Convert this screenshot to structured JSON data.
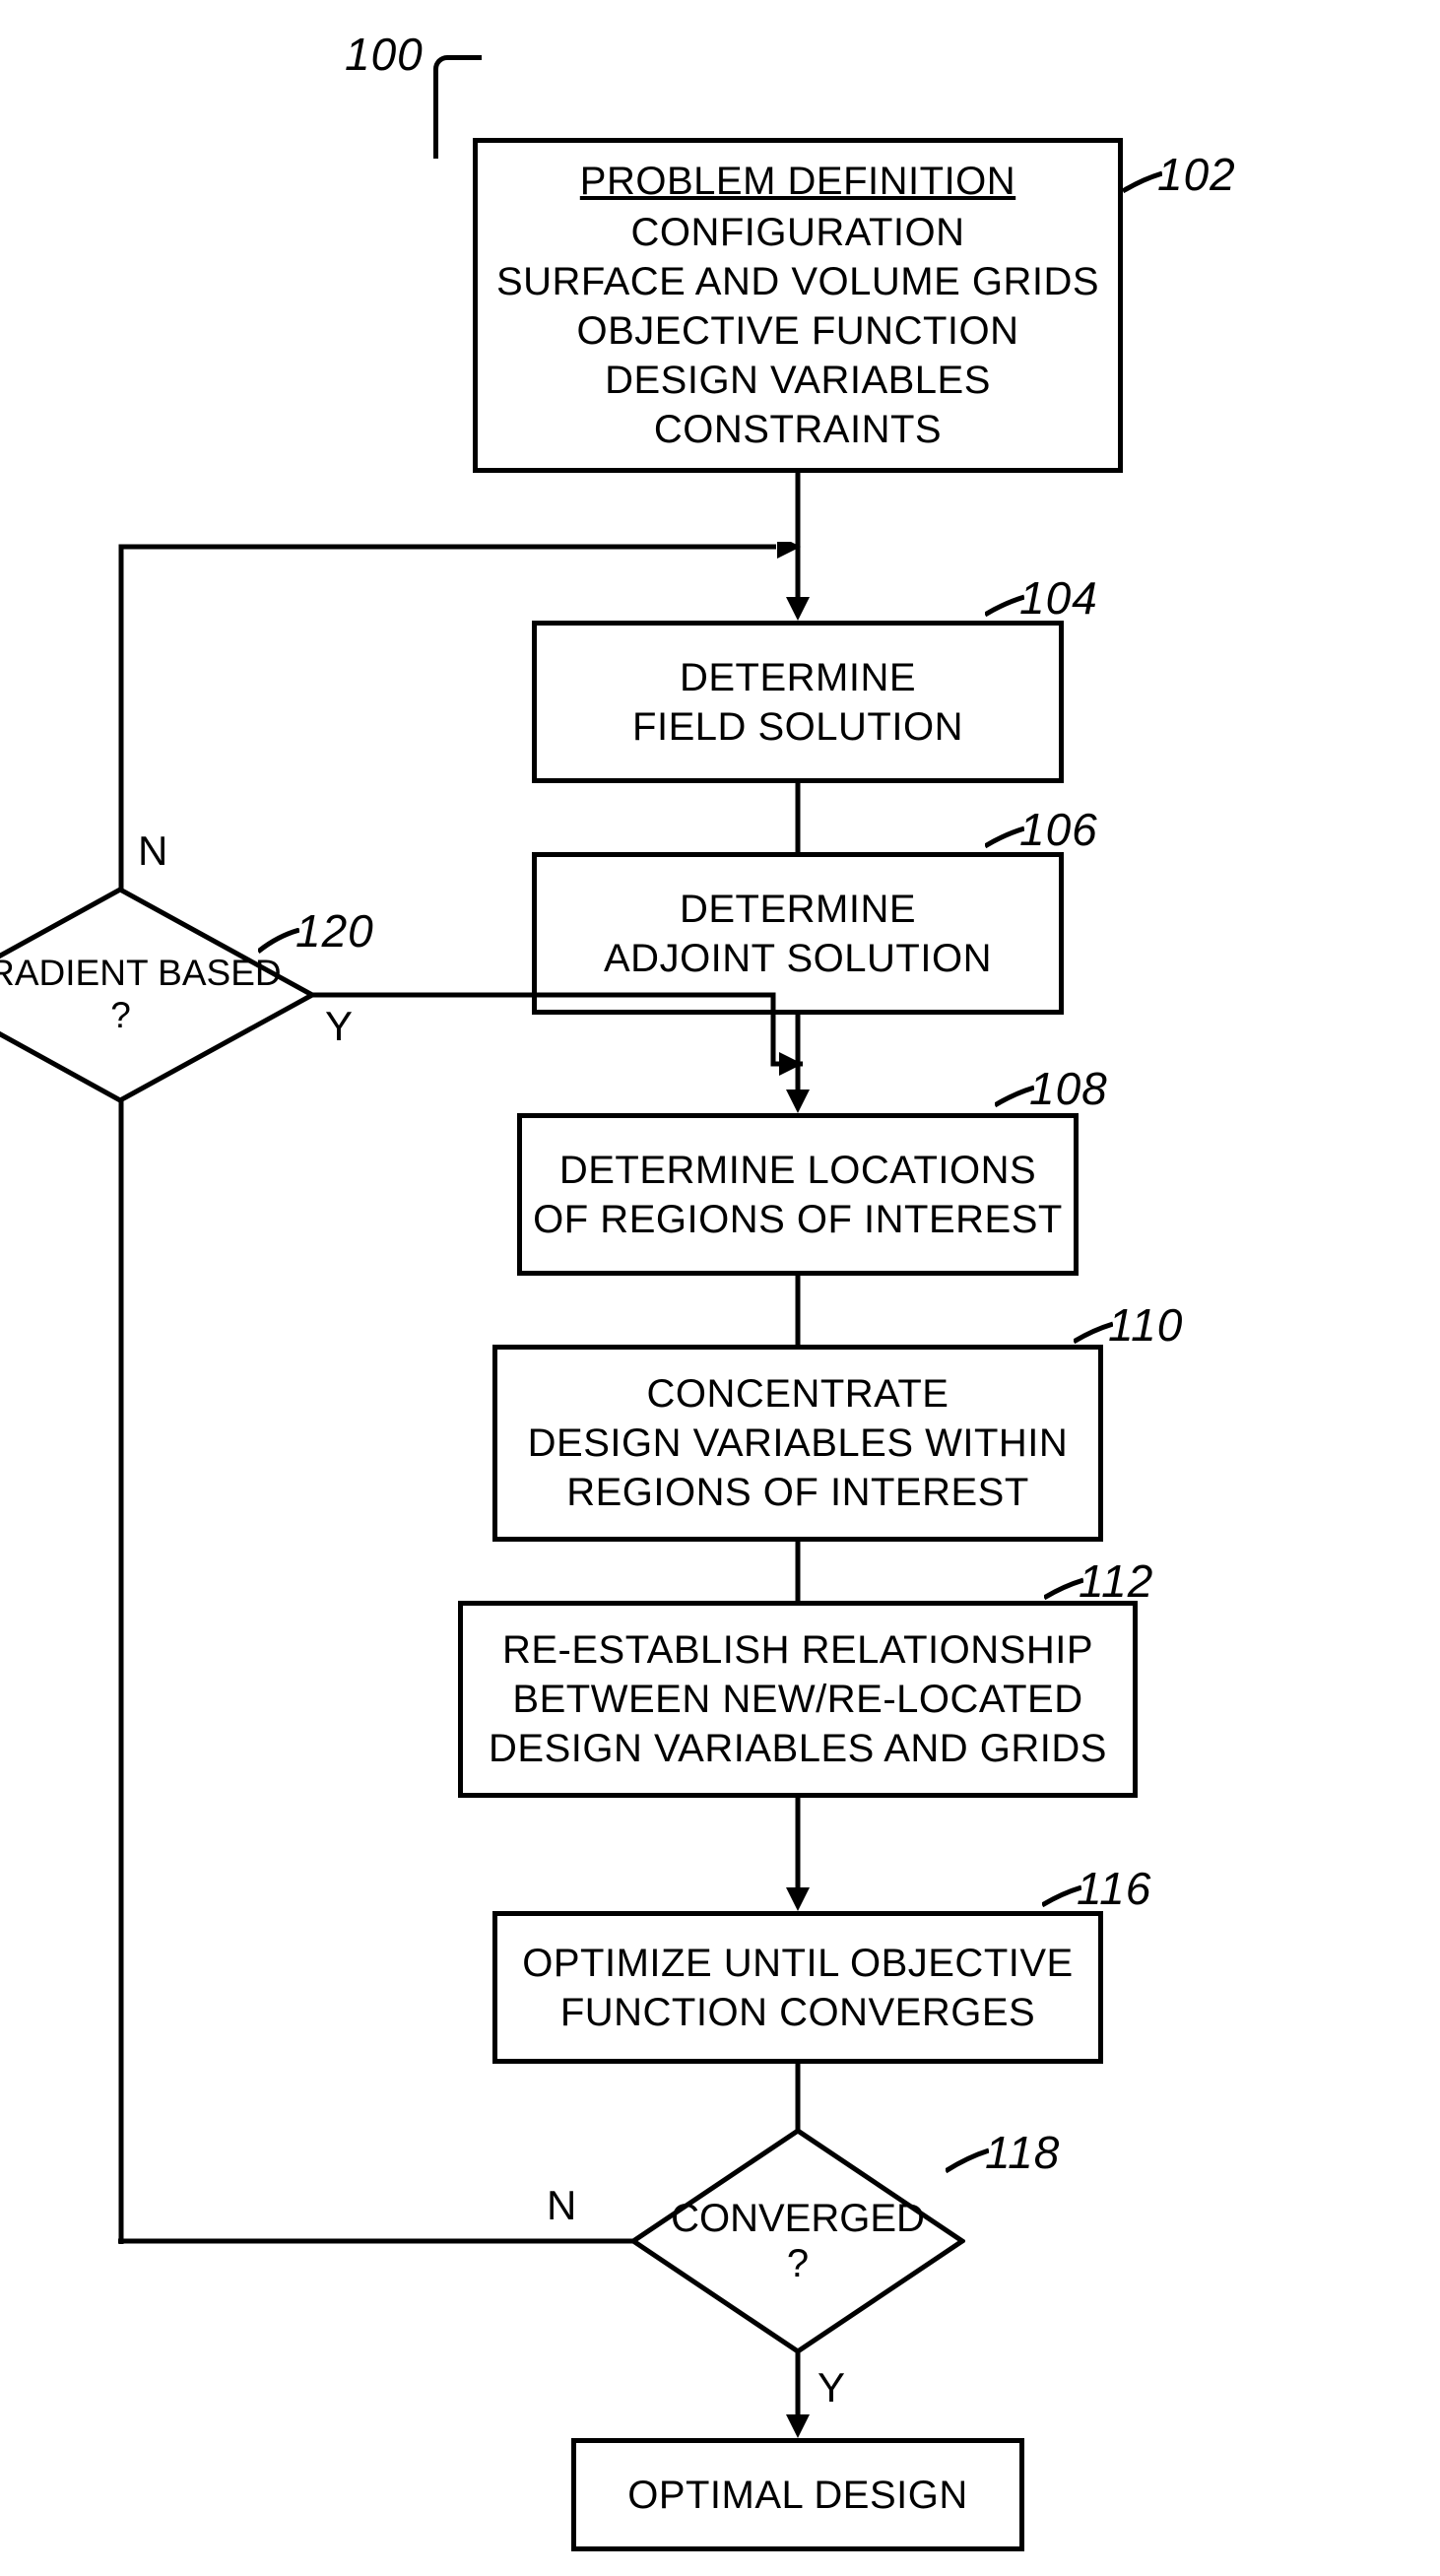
{
  "figure_label": "100",
  "boxes": {
    "b102": {
      "label": "102",
      "title": "PROBLEM DEFINITION",
      "lines": [
        "CONFIGURATION",
        "SURFACE AND VOLUME GRIDS",
        "OBJECTIVE FUNCTION",
        "DESIGN VARIABLES",
        "CONSTRAINTS"
      ]
    },
    "b104": {
      "label": "104",
      "lines": [
        "DETERMINE",
        "FIELD SOLUTION"
      ]
    },
    "b106": {
      "label": "106",
      "lines": [
        "DETERMINE",
        "ADJOINT SOLUTION"
      ]
    },
    "b108": {
      "label": "108",
      "lines": [
        "DETERMINE LOCATIONS",
        "OF REGIONS OF INTEREST"
      ]
    },
    "b110": {
      "label": "110",
      "lines": [
        "CONCENTRATE",
        "DESIGN VARIABLES WITHIN",
        "REGIONS OF INTEREST"
      ]
    },
    "b112": {
      "label": "112",
      "lines": [
        "RE-ESTABLISH RELATIONSHIP",
        "BETWEEN NEW/RE-LOCATED",
        "DESIGN VARIABLES AND GRIDS"
      ]
    },
    "b116": {
      "label": "116",
      "lines": [
        "OPTIMIZE UNTIL OBJECTIVE",
        "FUNCTION CONVERGES"
      ]
    },
    "bfinal": {
      "lines": [
        "OPTIMAL DESIGN"
      ]
    }
  },
  "diamonds": {
    "d120": {
      "label": "120",
      "lines": [
        "GRADIENT BASED",
        "?"
      ]
    },
    "d118": {
      "label": "118",
      "lines": [
        "CONVERGED",
        "?"
      ]
    }
  },
  "yn": {
    "Y": "Y",
    "N": "N"
  },
  "chart_data": {
    "type": "flowchart",
    "nodes": [
      {
        "id": "102",
        "kind": "process",
        "text": "PROBLEM DEFINITION: CONFIGURATION; SURFACE AND VOLUME GRIDS; OBJECTIVE FUNCTION; DESIGN VARIABLES; CONSTRAINTS"
      },
      {
        "id": "104",
        "kind": "process",
        "text": "DETERMINE FIELD SOLUTION"
      },
      {
        "id": "106",
        "kind": "process",
        "text": "DETERMINE ADJOINT SOLUTION"
      },
      {
        "id": "108",
        "kind": "process",
        "text": "DETERMINE LOCATIONS OF REGIONS OF INTEREST"
      },
      {
        "id": "110",
        "kind": "process",
        "text": "CONCENTRATE DESIGN VARIABLES WITHIN REGIONS OF INTEREST"
      },
      {
        "id": "112",
        "kind": "process",
        "text": "RE-ESTABLISH RELATIONSHIP BETWEEN NEW/RE-LOCATED DESIGN VARIABLES AND GRIDS"
      },
      {
        "id": "116",
        "kind": "process",
        "text": "OPTIMIZE UNTIL OBJECTIVE FUNCTION CONVERGES"
      },
      {
        "id": "118",
        "kind": "decision",
        "text": "CONVERGED ?"
      },
      {
        "id": "120",
        "kind": "decision",
        "text": "GRADIENT BASED ?"
      },
      {
        "id": "final",
        "kind": "terminal",
        "text": "OPTIMAL DESIGN"
      }
    ],
    "edges": [
      {
        "from": "102",
        "to": "104"
      },
      {
        "from": "104",
        "to": "106"
      },
      {
        "from": "106",
        "to": "108"
      },
      {
        "from": "108",
        "to": "110"
      },
      {
        "from": "110",
        "to": "112"
      },
      {
        "from": "112",
        "to": "116"
      },
      {
        "from": "116",
        "to": "118"
      },
      {
        "from": "118",
        "to": "final",
        "label": "Y"
      },
      {
        "from": "118",
        "to": "120",
        "label": "N"
      },
      {
        "from": "120",
        "to": "108",
        "label": "Y"
      },
      {
        "from": "120",
        "to": "104",
        "label": "N"
      }
    ]
  }
}
